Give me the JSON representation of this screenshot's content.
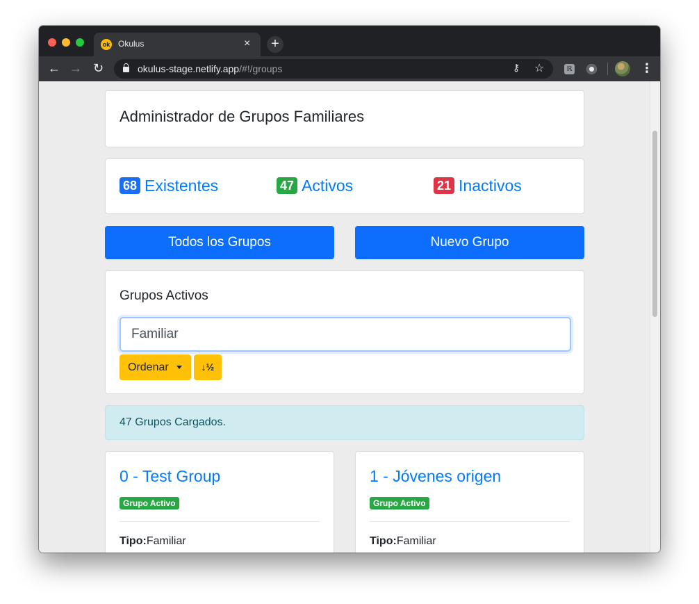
{
  "browser": {
    "tab_title": "Okulus",
    "favicon_text": "ok",
    "tab_close": "×",
    "new_tab": "+",
    "url_host": "okulus-stage.netlify.app",
    "url_path": "/#!/groups",
    "icons": [
      "back-icon",
      "forward-icon",
      "reload-icon",
      "lock-icon",
      "key-icon",
      "star-icon",
      "extension-icon",
      "profile-icon",
      "menu-icon"
    ]
  },
  "page": {
    "title": "Administrador de Grupos Familiares",
    "stats": [
      {
        "count": "68",
        "label": "Existentes",
        "color": "#1a6ef5"
      },
      {
        "count": "47",
        "label": "Activos",
        "color": "#28a745"
      },
      {
        "count": "21",
        "label": "Inactivos",
        "color": "#dc3545"
      }
    ],
    "buttons": {
      "all_groups": "Todos los Grupos",
      "new_group": "Nuevo Grupo"
    },
    "filter": {
      "title": "Grupos Activos",
      "search_value": "Familiar",
      "sort_label": "Ordenar",
      "sort_dir_label": "↓½"
    },
    "alert": "47 Grupos Cargados.",
    "groups": [
      {
        "name": "0 - Test Group",
        "status": "Grupo Activo",
        "type_label": "Tipo:",
        "type_value": "Familiar"
      },
      {
        "name": "1 - Jóvenes origen",
        "status": "Grupo Activo",
        "type_label": "Tipo:",
        "type_value": "Familiar"
      }
    ]
  }
}
